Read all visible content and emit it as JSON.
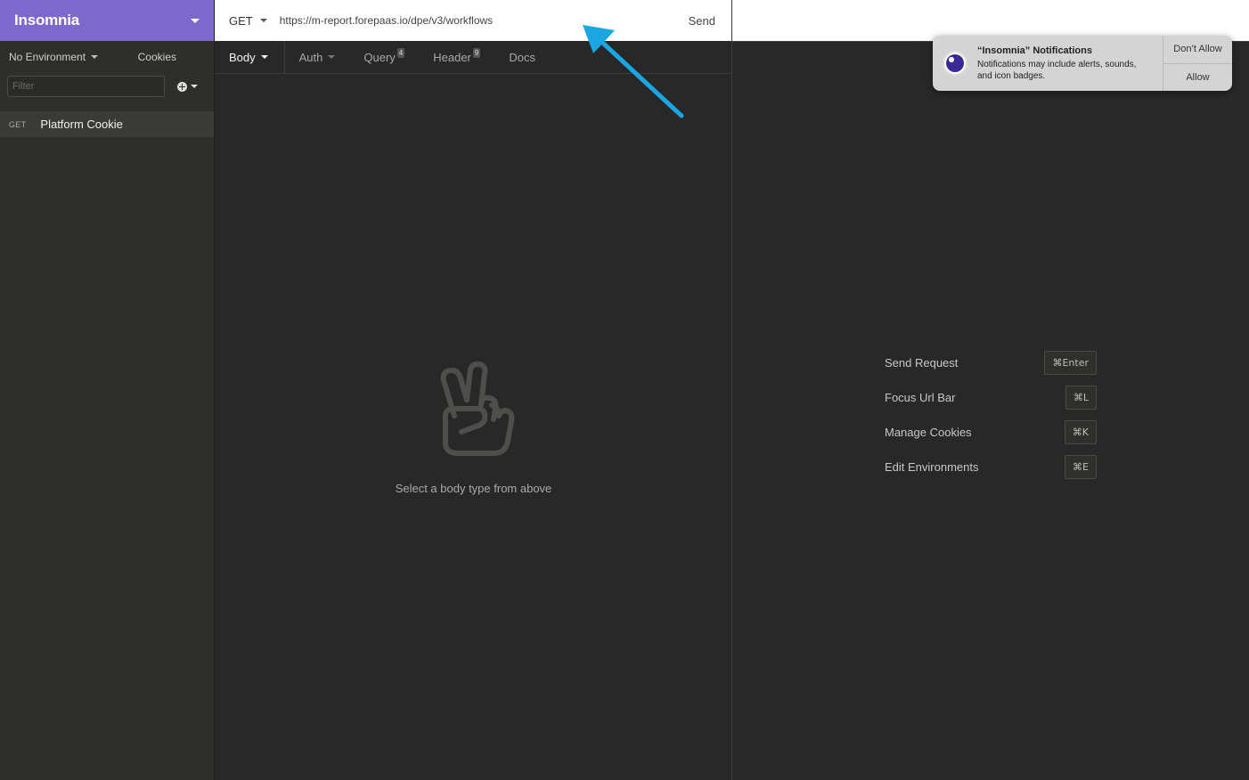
{
  "sidebar": {
    "workspace_title": "Insomnia",
    "environment_label": "No Environment",
    "cookies_label": "Cookies",
    "filter_placeholder": "Filter",
    "requests": [
      {
        "method": "GET",
        "name": "Platform Cookie"
      }
    ]
  },
  "request": {
    "method": "GET",
    "url": "https://m-report.forepaas.io/dpe/v3/workflows",
    "send_label": "Send",
    "tabs": [
      {
        "label": "Body"
      },
      {
        "label": "Auth"
      },
      {
        "label": "Query",
        "badge": "4"
      },
      {
        "label": "Header",
        "badge": "9"
      },
      {
        "label": "Docs"
      }
    ],
    "empty_message": "Select a body type from above"
  },
  "shortcuts": [
    {
      "label": "Send Request",
      "key": "⌘Enter"
    },
    {
      "label": "Focus Url Bar",
      "key": "⌘L"
    },
    {
      "label": "Manage Cookies",
      "key": "⌘K"
    },
    {
      "label": "Edit Environments",
      "key": "⌘E"
    }
  ],
  "notification": {
    "title": "“Insomnia” Notifications",
    "message": "Notifications may include alerts, sounds, and icon badges.",
    "dont_allow_label": "Don’t Allow",
    "allow_label": "Allow"
  },
  "colors": {
    "brand": "#7d69cb",
    "background": "#282828",
    "annotation_arrow": "#1aa6e0"
  }
}
